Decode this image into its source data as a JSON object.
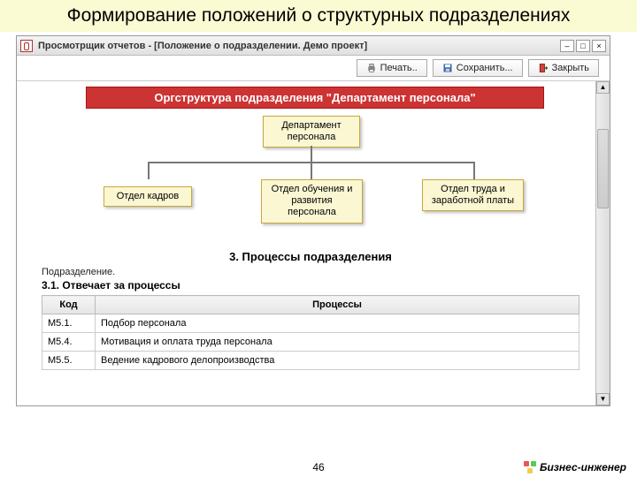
{
  "slide": {
    "title": "Формирование положений о структурных подразделениях",
    "page_number": "46",
    "brand": "Бизнес-инженер"
  },
  "window": {
    "title": "Просмотрщик отчетов -  [Положение о подразделении. Демо проект]"
  },
  "toolbar": {
    "print": "Печать..",
    "save": "Сохранить...",
    "close": "Закрыть"
  },
  "org": {
    "banner": "Оргструктура подразделения \"Департамент персонала\"",
    "root": "Департамент персонала",
    "children": [
      "Отдел кадров",
      "Отдел обучения и развития персонала",
      "Отдел труда и заработной платы"
    ]
  },
  "section": {
    "number_title": "3. Процессы подразделения",
    "dept_label": "Подразделение.",
    "subhead": "3.1. Отвечает за процессы"
  },
  "table": {
    "headers": {
      "code": "Код",
      "process": "Процессы"
    },
    "rows": [
      {
        "code": "M5.1.",
        "process": "Подбор персонала"
      },
      {
        "code": "M5.4.",
        "process": "Мотивация и оплата труда персонала"
      },
      {
        "code": "M5.5.",
        "process": "Ведение кадрового делопроизводства"
      }
    ]
  }
}
